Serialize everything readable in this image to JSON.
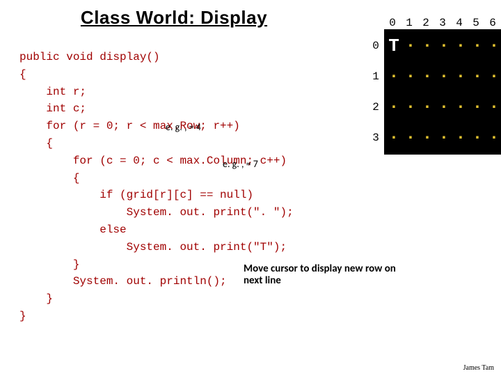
{
  "title": "Class World: Display",
  "code_lines": [
    "public void display()",
    "{",
    "    int r;",
    "    int c;",
    "    for (r = 0; r < max.Row; r++)",
    "    {",
    "        for (c = 0; c < max.Column; c++)",
    "        {",
    "            if (grid[r][c] == null)",
    "                System. out. print(\". \");",
    "            else",
    "                System. out. print(\"T\");",
    "        }",
    "        System. out. println();",
    "    }",
    "}"
  ],
  "annotations": {
    "eg1": "e. g. , = 4",
    "eg2": "e. g. , = 7",
    "move_cursor": "Move cursor to display new row on next line"
  },
  "grid": {
    "cols": [
      "0",
      "1",
      "2",
      "3",
      "4",
      "5",
      "6"
    ],
    "rows": [
      "0",
      "1",
      "2",
      "3"
    ],
    "cells": [
      [
        "T",
        ".",
        ".",
        ".",
        ".",
        ".",
        "."
      ],
      [
        ".",
        ".",
        ".",
        ".",
        ".",
        ".",
        "."
      ],
      [
        ".",
        ".",
        ".",
        ".",
        ".",
        ".",
        "."
      ],
      [
        ".",
        ".",
        ".",
        ".",
        ".",
        ".",
        "."
      ]
    ]
  },
  "credit": "James Tam"
}
